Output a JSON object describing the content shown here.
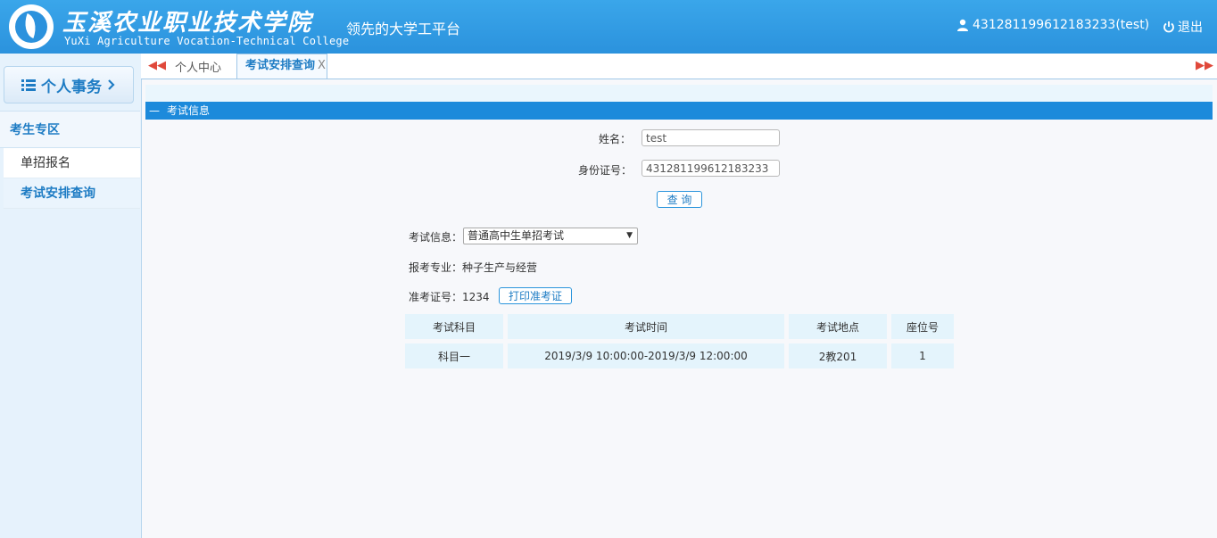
{
  "header": {
    "college_name_cn": "玉溪农业职业技术学院",
    "college_name_en": "YuXi Agriculture Vocation-Technical College",
    "platform_title": "领先的大学工平台",
    "user_label": "431281199612183233(test)",
    "logout_label": "退出"
  },
  "sidebar": {
    "title": "个人事务",
    "group_label": "考生专区",
    "items": [
      {
        "label": "单招报名"
      },
      {
        "label": "考试安排查询"
      }
    ]
  },
  "tabs": [
    {
      "label": "个人中心"
    },
    {
      "label": "考试安排查询",
      "close": "X"
    }
  ],
  "section": {
    "dash": "—",
    "title": "考试信息"
  },
  "form": {
    "name_label": "姓名：",
    "name_value": "test",
    "id_label": "身份证号：",
    "id_value": "431281199612183233",
    "query_button": "查 询"
  },
  "exam": {
    "info_label": "考试信息：",
    "info_selected": "普通高中生单招考试",
    "major_text": "报考专业：种子生产与经营",
    "ticket_text": "准考证号：1234",
    "print_button": "打印准考证"
  },
  "table": {
    "headers": [
      "考试科目",
      "考试时间",
      "考试地点",
      "座位号"
    ],
    "rows": [
      [
        "科目一",
        "2019/3/9 10:00:00-2019/3/9 12:00:00",
        "2教201",
        "1"
      ]
    ]
  },
  "colors": {
    "header_blue": "#2b92dd",
    "accent_blue": "#1c8adb",
    "arrow_red": "#e0483a"
  }
}
